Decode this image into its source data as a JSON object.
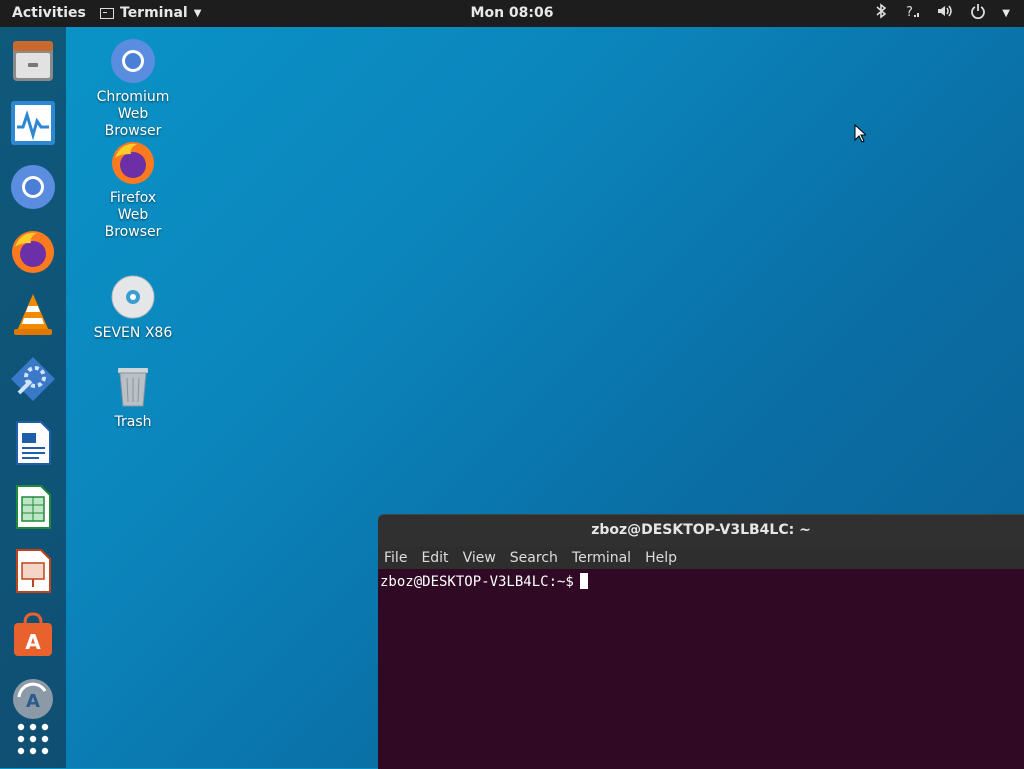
{
  "topbar": {
    "activities": "Activities",
    "app_menu": "Terminal",
    "clock": "Mon 08:06",
    "icons": [
      "bluetooth-icon",
      "network-icon",
      "volume-icon",
      "power-icon",
      "chevron-down-icon"
    ]
  },
  "dock": {
    "items": [
      "files-icon",
      "system-monitor-icon",
      "chromium-icon",
      "firefox-icon",
      "vlc-icon",
      "settings-icon",
      "libreoffice-writer-icon",
      "libreoffice-calc-icon",
      "libreoffice-impress-icon",
      "software-center-icon",
      "software-updater-icon",
      "show-applications-icon"
    ]
  },
  "desktop": {
    "icons": [
      {
        "label": "Chromium\nWeb\nBrowser"
      },
      {
        "label": "Firefox\nWeb\nBrowser"
      },
      {
        "label": "SEVEN X86"
      },
      {
        "label": "Trash"
      }
    ]
  },
  "terminal": {
    "title": "zboz@DESKTOP-V3LB4LC: ~",
    "menu": [
      "File",
      "Edit",
      "View",
      "Search",
      "Terminal",
      "Help"
    ],
    "prompt": "zboz@DESKTOP-V3LB4LC:~$"
  },
  "colors": {
    "terminal_bg": "#300a24",
    "topbar_bg": "#1d1d1d",
    "desktop_bg": "#0a86bd"
  }
}
